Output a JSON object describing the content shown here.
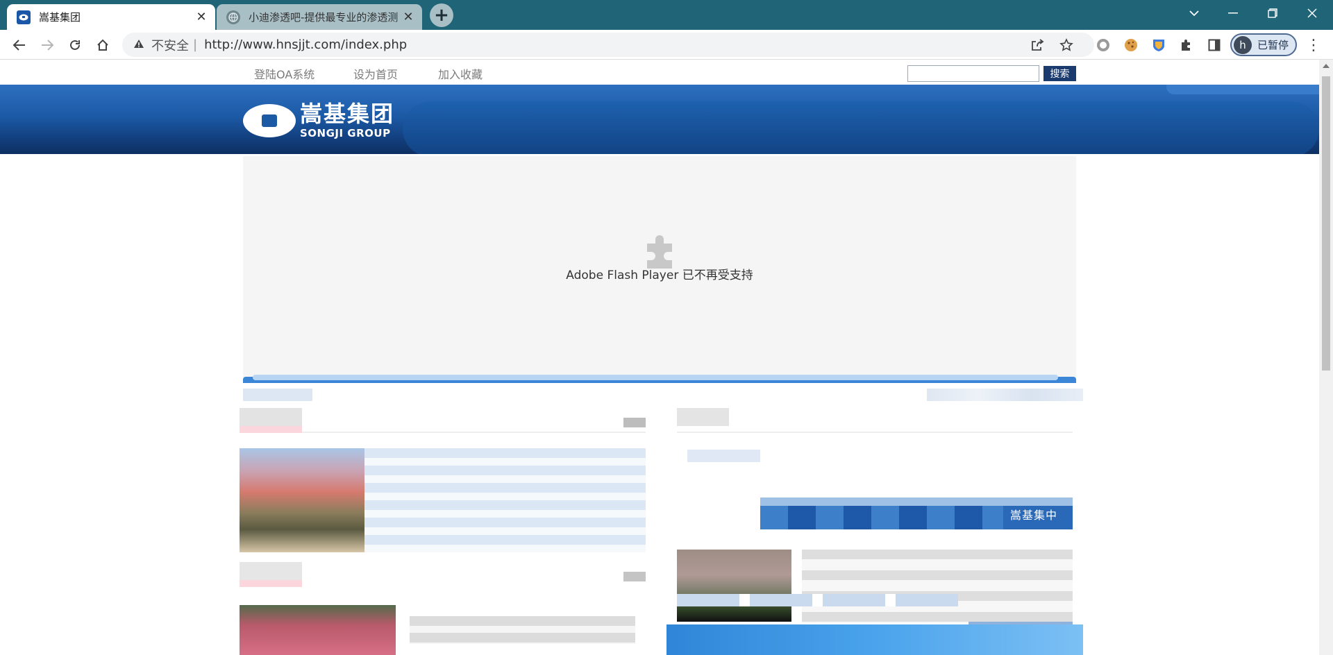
{
  "browser": {
    "tabs": [
      {
        "title": "嵩基集团",
        "active": true
      },
      {
        "title": "小迪渗透吧-提供最专业的渗透测",
        "active": false
      }
    ],
    "new_tab_icon": "plus-icon",
    "address": {
      "security_label": "不安全",
      "separator": "|",
      "url": "http://www.hnsjjt.com/index.php"
    },
    "profile": {
      "initial": "h",
      "status": "已暂停"
    }
  },
  "page": {
    "top_links": [
      "登陆OA系统",
      "设为首页",
      "加入收藏"
    ],
    "search": {
      "placeholder": "",
      "button_label": "搜索"
    },
    "logo": {
      "cn": "嵩基集团",
      "en": "SONGJI GROUP"
    },
    "flash_message": "Adobe Flash Player 已不再受支持",
    "featured_label": "嵩基集中"
  },
  "colors": {
    "tabbar": "#1f6477",
    "banner_blue": "#1c5aa6",
    "search_button": "#1b3b6e",
    "flash_bg": "#f5f5f5"
  }
}
